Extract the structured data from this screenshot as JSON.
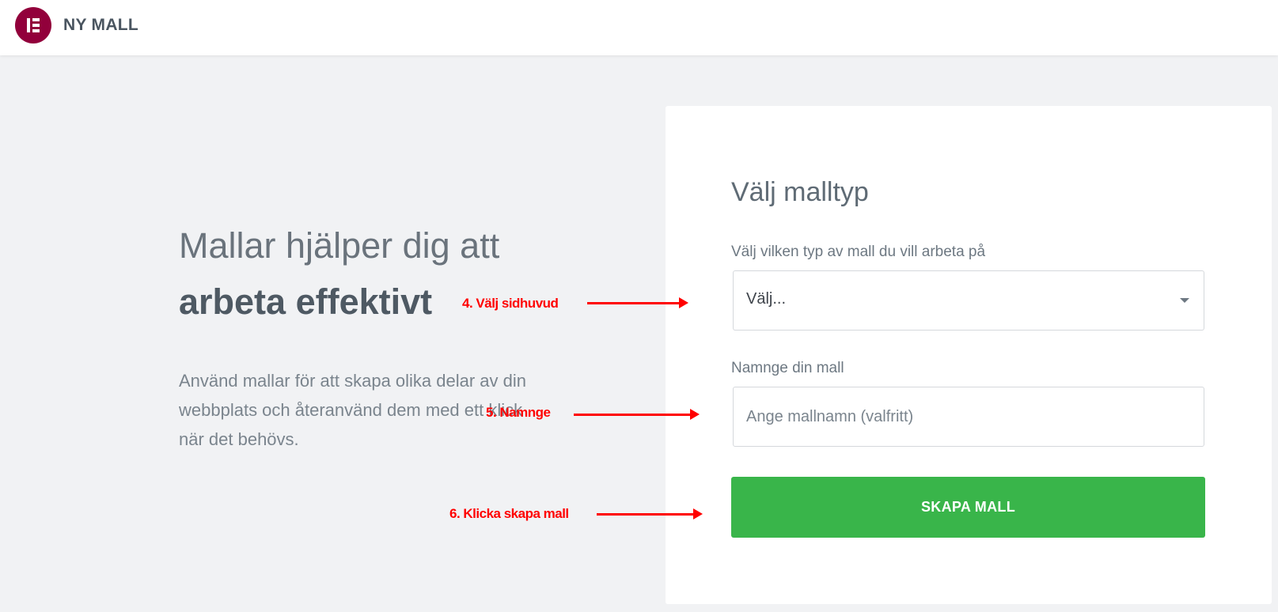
{
  "header": {
    "title": "NY MALL",
    "logo_icon": "elementor-logo-icon",
    "logo_color": "#92003b"
  },
  "intro": {
    "headline_line1": "Mallar hjälper dig att",
    "headline_line2": "arbeta effektivt",
    "description": "Använd mallar för att skapa olika delar av din webbplats och återanvänd dem med ett klick när det behövs."
  },
  "form": {
    "title": "Välj malltyp",
    "type_label": "Välj vilken typ av mall du vill arbeta på",
    "type_selected": "Välj...",
    "name_label": "Namnge din mall",
    "name_placeholder": "Ange mallnamn (valfritt)",
    "name_value": "",
    "submit_label": "SKAPA MALL",
    "submit_color": "#39b54a"
  },
  "annotations": {
    "step4": "4. Välj sidhuvud",
    "step5": "5. Namnge",
    "step6": "6. Klicka skapa mall",
    "color": "#ff0000"
  }
}
